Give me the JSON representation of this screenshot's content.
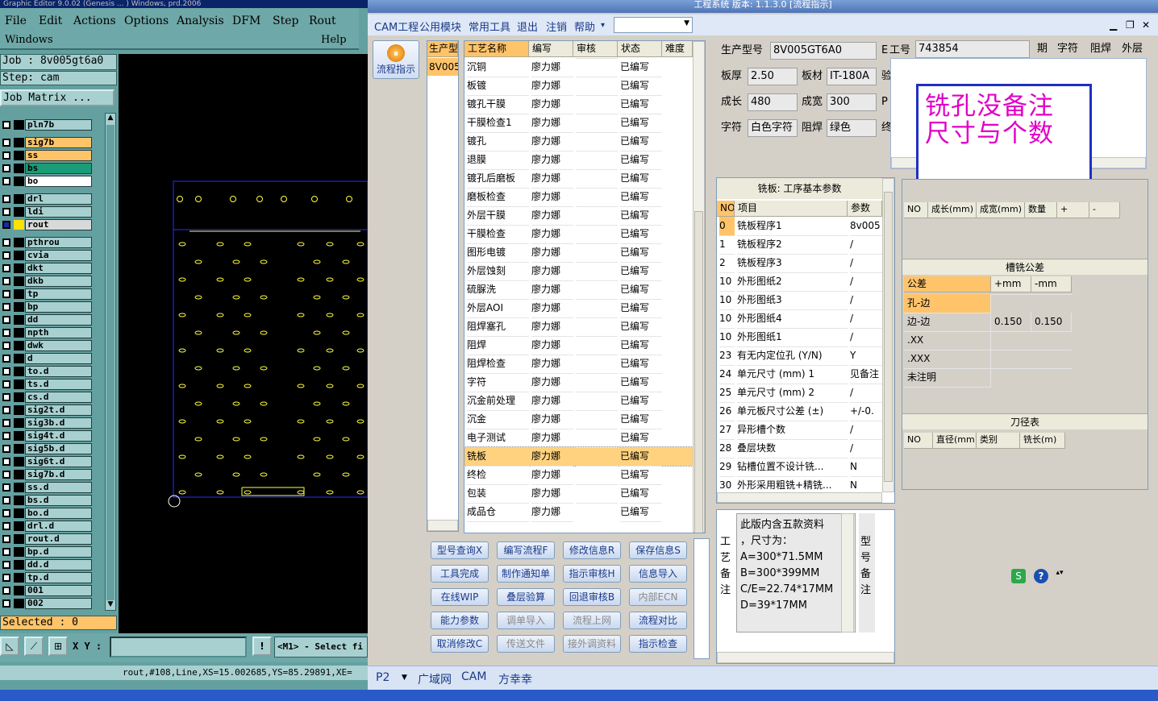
{
  "ge": {
    "title": "Graphic Editor 9.0.02 (Genesis ... ) Windows, prd.2006",
    "menu": {
      "file": "File",
      "edit": "Edit",
      "actions": "Actions",
      "options": "Options",
      "analysis": "Analysis",
      "dfm": "DFM",
      "step": "Step",
      "rout": "Rout",
      "windows": "Windows",
      "help": "Help"
    },
    "job": "Job : 8v005gt6a0",
    "step": "Step: cam",
    "job_matrix": "Job Matrix ...",
    "layers": [
      "pln7b",
      "sig7b",
      "ss",
      "bs",
      "bo",
      "drl",
      "ldi",
      "rout",
      "pthrou",
      "cvia",
      "dkt",
      "dkb",
      "tp",
      "bp",
      "dd",
      "npth",
      "dwk",
      "d",
      "to.d",
      "ts.d",
      "cs.d",
      "sig2t.d",
      "sig3b.d",
      "sig4t.d",
      "sig5b.d",
      "sig6t.d",
      "sig7b.d",
      "ss.d",
      "bs.d",
      "bo.d",
      "drl.d",
      "rout.d",
      "bp.d",
      "dd.d",
      "tp.d",
      "001",
      "002"
    ],
    "selected": "Selected : 0",
    "xy_label": "X Y :",
    "xy_value": "",
    "prompt": "<M1> - Select fi",
    "status": "rout,#108,Line,XS=15.002685,YS=85.29891,XE="
  },
  "cam": {
    "title": "工程系统 版本: 1.1.3.0 [流程指示]",
    "menu": [
      "CAM工程",
      "公用模块",
      "常用工具",
      "退出",
      "注销",
      "帮助"
    ],
    "flow_btn": "流程指示",
    "model_col": {
      "header": "生产型",
      "value": "8V005"
    },
    "process_table": {
      "headers": [
        "工艺名称",
        "编写",
        "审核",
        "状态",
        "难度"
      ],
      "rows": [
        [
          "沉铜",
          "廖力娜",
          "",
          "已编写"
        ],
        [
          "板镀",
          "廖力娜",
          "",
          "已编写"
        ],
        [
          "镀孔干膜",
          "廖力娜",
          "",
          "已编写"
        ],
        [
          "干膜检查1",
          "廖力娜",
          "",
          "已编写"
        ],
        [
          "镀孔",
          "廖力娜",
          "",
          "已编写"
        ],
        [
          "退膜",
          "廖力娜",
          "",
          "已编写"
        ],
        [
          "镀孔后磨板",
          "廖力娜",
          "",
          "已编写"
        ],
        [
          "磨板检查",
          "廖力娜",
          "",
          "已编写"
        ],
        [
          "外层干膜",
          "廖力娜",
          "",
          "已编写"
        ],
        [
          "干膜检查",
          "廖力娜",
          "",
          "已编写"
        ],
        [
          "图形电镀",
          "廖力娜",
          "",
          "已编写"
        ],
        [
          "外层蚀刻",
          "廖力娜",
          "",
          "已编写"
        ],
        [
          "硫脲洗",
          "廖力娜",
          "",
          "已编写"
        ],
        [
          "外层AOI",
          "廖力娜",
          "",
          "已编写"
        ],
        [
          "阻焊塞孔",
          "廖力娜",
          "",
          "已编写"
        ],
        [
          "阻焊",
          "廖力娜",
          "",
          "已编写"
        ],
        [
          "阻焊检查",
          "廖力娜",
          "",
          "已编写"
        ],
        [
          "字符",
          "廖力娜",
          "",
          "已编写"
        ],
        [
          "沉金前处理",
          "廖力娜",
          "",
          "已编写"
        ],
        [
          "沉金",
          "廖力娜",
          "",
          "已编写"
        ],
        [
          "电子测试",
          "廖力娜",
          "",
          "已编写"
        ],
        [
          "铣板",
          "廖力娜",
          "",
          "已编写"
        ],
        [
          "终检",
          "廖力娜",
          "",
          "已编写"
        ],
        [
          "包装",
          "廖力娜",
          "",
          "已编写"
        ],
        [
          "成品仓",
          "廖力娜",
          "",
          "已编写"
        ]
      ],
      "selected_index": 21
    },
    "buttons": [
      {
        "label": "型号查询X",
        "disabled": false
      },
      {
        "label": "编写流程F",
        "disabled": false
      },
      {
        "label": "修改信息R",
        "disabled": false
      },
      {
        "label": "保存信息S",
        "disabled": false
      },
      {
        "label": "工具完成",
        "disabled": false
      },
      {
        "label": "制作通知单",
        "disabled": false
      },
      {
        "label": "指示审核H",
        "disabled": false
      },
      {
        "label": "信息导入",
        "disabled": false
      },
      {
        "label": "在线WIP",
        "disabled": false
      },
      {
        "label": "叠层验算",
        "disabled": false
      },
      {
        "label": "回退审核B",
        "disabled": false
      },
      {
        "label": "内部ECN",
        "disabled": true
      },
      {
        "label": "能力参数",
        "disabled": false
      },
      {
        "label": "调单导入",
        "disabled": true
      },
      {
        "label": "流程上网",
        "disabled": true
      },
      {
        "label": "流程对比",
        "disabled": false
      },
      {
        "label": "取消修改C",
        "disabled": false
      },
      {
        "label": "传送文件",
        "disabled": true
      },
      {
        "label": "接外调资料",
        "disabled": true
      },
      {
        "label": "指示检查",
        "disabled": false
      }
    ],
    "info": {
      "model_label": "生产型号",
      "model_value": "8V005GT6A0",
      "job_label": "工号",
      "job_prefix": "E",
      "job_value": "743854",
      "thickness_label": "板厚",
      "thickness_value": "2.50",
      "material_label": "板材",
      "material_value": "IT-180A",
      "material_after": "验",
      "length_label": "成长",
      "length_value": "480",
      "width_label": "成宽",
      "width_value": "300",
      "width_after": "P",
      "char_label": "字符",
      "char_value": "白色字符",
      "mask_label": "阻焊",
      "mask_value": "绿色",
      "mask_after": "终",
      "top_cols": [
        "期",
        "字符",
        "阻焊",
        "外层"
      ]
    },
    "annotation": "铣孔没备注\n尺寸与个数",
    "params": {
      "title": "铣板: 工序基本参数",
      "headers": [
        "NO",
        "项目",
        "参数"
      ],
      "rows": [
        [
          "0",
          "铣板程序1",
          "8v005"
        ],
        [
          "1",
          "铣板程序2",
          "/"
        ],
        [
          "2",
          "铣板程序3",
          "/"
        ],
        [
          "10",
          "外形图纸2",
          "/"
        ],
        [
          "10",
          "外形图纸3",
          "/"
        ],
        [
          "10",
          "外形图纸4",
          "/"
        ],
        [
          "10",
          "外形图纸1",
          "/"
        ],
        [
          "23",
          "有无内定位孔 (Y/N)",
          "Y"
        ],
        [
          "24",
          "单元尺寸 (mm) 1",
          "见备注"
        ],
        [
          "25",
          "单元尺寸 (mm) 2",
          "/"
        ],
        [
          "26",
          "单元板尺寸公差 (±)",
          "+/-0."
        ],
        [
          "27",
          "异形槽个数",
          "/"
        ],
        [
          "28",
          "叠层块数",
          "/"
        ],
        [
          "29",
          "钻槽位置不设计铣...",
          "N"
        ],
        [
          "30",
          "外形采用粗铣+精铣...",
          "N"
        ]
      ]
    },
    "size_table": {
      "headers": [
        "NO",
        "成长(mm)",
        "成宽(mm)",
        "数量",
        "+",
        "-"
      ]
    },
    "tolerance": {
      "title": "槽铣公差",
      "headers": [
        "公差",
        "+mm",
        "-mm"
      ],
      "rows": [
        [
          "孔-边",
          "",
          ""
        ],
        [
          "边-边",
          "0.150",
          "0.150"
        ],
        [
          ".XX",
          "",
          ""
        ],
        [
          ".XXX",
          "",
          ""
        ],
        [
          "未注明",
          "",
          ""
        ]
      ]
    },
    "cutter": {
      "title": "刀径表",
      "headers": [
        "NO",
        "直径(mm)",
        "类别",
        "铣长(m)"
      ]
    },
    "remarks": {
      "side_label": "工艺备注",
      "text": [
        "此版内含五款资料",
        "，尺寸为：",
        "A=300*71.5MM",
        "B=300*399MM",
        "C/E=22.74*17MM",
        "D=39*17MM"
      ],
      "model_remark_label": "型号备注"
    },
    "tabs": [
      "P2",
      "广域网",
      "CAM",
      "方幸幸"
    ]
  },
  "colors": {
    "accent_orange": "#ffc46a",
    "highlight_row": "#ffd27f",
    "annotation_text": "#e000c8",
    "annotation_border": "#2030c0"
  }
}
